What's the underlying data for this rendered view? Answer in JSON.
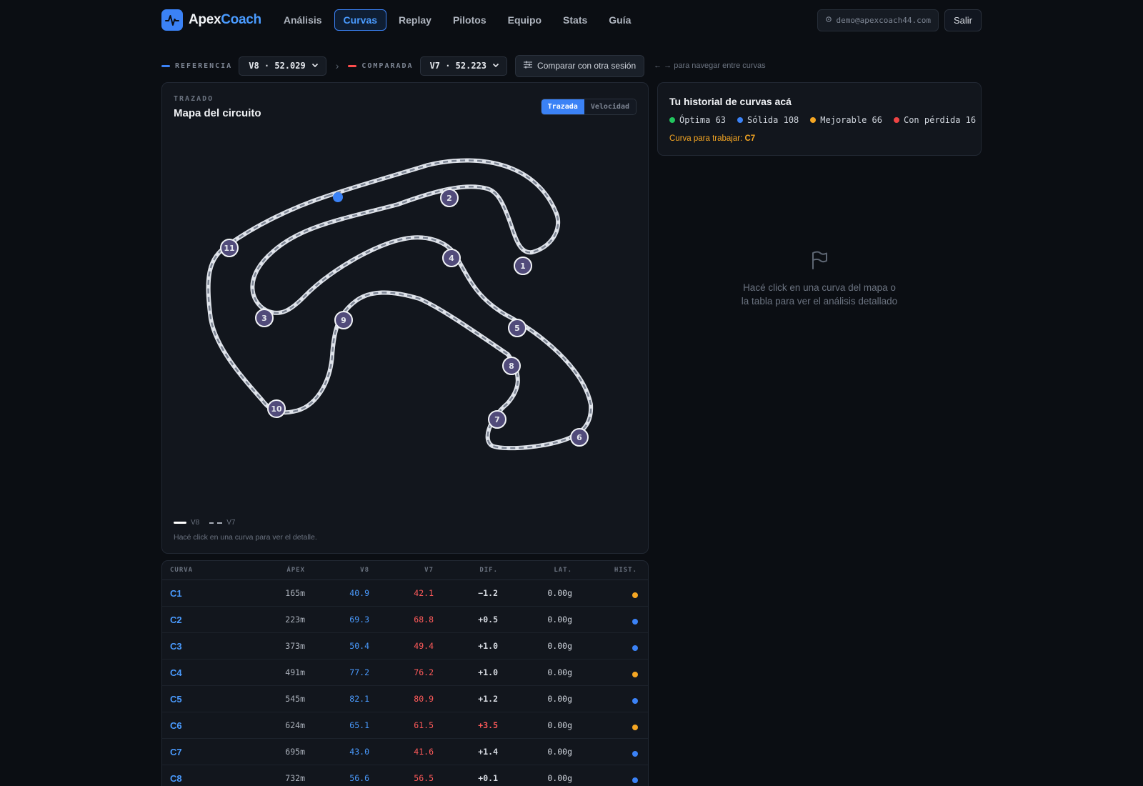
{
  "app": {
    "name_part1": "Apex",
    "name_part2": "Coach"
  },
  "nav": [
    {
      "label": "Análisis",
      "active": false
    },
    {
      "label": "Curvas",
      "active": true
    },
    {
      "label": "Replay",
      "active": false
    },
    {
      "label": "Pilotos",
      "active": false
    },
    {
      "label": "Equipo",
      "active": false
    },
    {
      "label": "Stats",
      "active": false
    },
    {
      "label": "Guía",
      "active": false
    }
  ],
  "user": {
    "email": "demo@apexcoach44.com",
    "logout_label": "Salir"
  },
  "compare": {
    "ref_label": "REFERENCIA",
    "ref_value": "V8 · 52.029",
    "cmp_label": "COMPARADA",
    "cmp_value": "V7 · 52.223",
    "other_session_label": "Comparar con otra sesión",
    "nav_hint": "← → para navegar entre curvas",
    "ref_color": "#3b82f6",
    "cmp_color": "#ff4d4d"
  },
  "map": {
    "eyebrow": "TRAZADO",
    "title": "Mapa del circuito",
    "toggle": [
      "Trazada",
      "Velocidad"
    ],
    "active_toggle": "Trazada",
    "turn_labels": [
      "1",
      "2",
      "3",
      "4",
      "5",
      "6",
      "7",
      "8",
      "9",
      "10",
      "11"
    ],
    "legend": {
      "ref": "V8",
      "cmp": "V7"
    },
    "footer": "Hacé click en una curva para ver el detalle."
  },
  "history": {
    "title": "Tu historial de curvas acá",
    "stats": [
      {
        "label": "Óptima 63",
        "color": "#22c55e"
      },
      {
        "label": "Sólida 108",
        "color": "#3b82f6"
      },
      {
        "label": "Mejorable 66",
        "color": "#f5a623"
      },
      {
        "label": "Con pérdida 16",
        "color": "#ef4444"
      }
    ],
    "work_prefix": "Curva para trabajar: ",
    "work_turn": "C7"
  },
  "empty_state": {
    "icon": "flag-icon",
    "line1": "Hacé click en una curva del mapa o",
    "line2": "la tabla para ver el análisis detallado"
  },
  "table": {
    "headers": [
      "CURVA",
      "ÁPEX",
      "V8",
      "V7",
      "DIF.",
      "LAT.",
      "HIST."
    ],
    "rows": [
      {
        "curve": "C1",
        "apex": "165m",
        "v8": "40.9",
        "v7": "42.1",
        "dif": "−1.2",
        "lat": "0.00g",
        "hist_color": "#f5a623",
        "dif_color": "#d8dce3"
      },
      {
        "curve": "C2",
        "apex": "223m",
        "v8": "69.3",
        "v7": "68.8",
        "dif": "+0.5",
        "lat": "0.00g",
        "hist_color": "#3b82f6",
        "dif_color": "#d8dce3"
      },
      {
        "curve": "C3",
        "apex": "373m",
        "v8": "50.4",
        "v7": "49.4",
        "dif": "+1.0",
        "lat": "0.00g",
        "hist_color": "#3b82f6",
        "dif_color": "#d8dce3"
      },
      {
        "curve": "C4",
        "apex": "491m",
        "v8": "77.2",
        "v7": "76.2",
        "dif": "+1.0",
        "lat": "0.00g",
        "hist_color": "#f5a623",
        "dif_color": "#d8dce3"
      },
      {
        "curve": "C5",
        "apex": "545m",
        "v8": "82.1",
        "v7": "80.9",
        "dif": "+1.2",
        "lat": "0.00g",
        "hist_color": "#3b82f6",
        "dif_color": "#d8dce3"
      },
      {
        "curve": "C6",
        "apex": "624m",
        "v8": "65.1",
        "v7": "61.5",
        "dif": "+3.5",
        "lat": "0.00g",
        "hist_color": "#f5a623",
        "dif_color": "#ff5a5a"
      },
      {
        "curve": "C7",
        "apex": "695m",
        "v8": "43.0",
        "v7": "41.6",
        "dif": "+1.4",
        "lat": "0.00g",
        "hist_color": "#3b82f6",
        "dif_color": "#d8dce3"
      },
      {
        "curve": "C8",
        "apex": "732m",
        "v8": "56.6",
        "v7": "56.5",
        "dif": "+0.1",
        "lat": "0.00g",
        "hist_color": "#3b82f6",
        "dif_color": "#d8dce3"
      }
    ]
  }
}
